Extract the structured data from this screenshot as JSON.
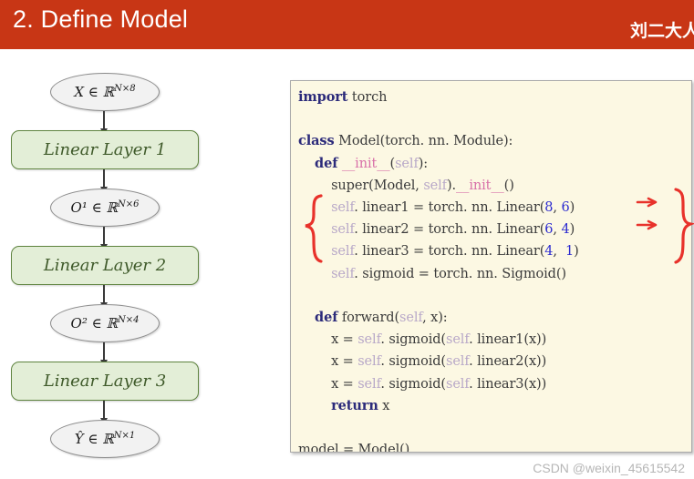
{
  "header": {
    "title": "2. Define Model",
    "author": "刘二大人",
    "bg_color": "#c83615",
    "text_color": "#ffffff"
  },
  "diagram": {
    "nodes": [
      {
        "kind": "ellipse",
        "label": "X ∈ ℝ",
        "sup": "N×8",
        "name": "node-input-x"
      },
      {
        "kind": "box",
        "label": "Linear Layer 1",
        "name": "node-linear-layer-1"
      },
      {
        "kind": "ellipse",
        "label": "O¹ ∈ ℝ",
        "sup": "N×6",
        "name": "node-output-o1"
      },
      {
        "kind": "box",
        "label": "Linear Layer 2",
        "name": "node-linear-layer-2"
      },
      {
        "kind": "ellipse",
        "label": "O² ∈ ℝ",
        "sup": "N×4",
        "name": "node-output-o2"
      },
      {
        "kind": "box",
        "label": "Linear Layer 3",
        "name": "node-linear-layer-3"
      },
      {
        "kind": "ellipse",
        "label": "Ŷ ∈ ℝ",
        "sup": "N×1",
        "name": "node-output-yhat"
      }
    ],
    "ellipse_fill": "#f2f2f2",
    "ellipse_stroke": "#8c8c8c",
    "box_fill": "#e3eed7",
    "box_stroke": "#5f8440",
    "box_text_color": "#3f5a2a",
    "arrow_color": "#3a3a3a"
  },
  "code": {
    "background": "#fcf8e3",
    "border": "#aaaaaa",
    "keyword_color": "#2b2a7a",
    "magic_color": "#d86fa8",
    "self_color": "#b8a8c8",
    "number_color": "#2b2ad0",
    "plain_color": "#3b3b3b",
    "lines": [
      {
        "tokens": [
          {
            "t": "import",
            "c": "kw"
          },
          {
            "t": " torch",
            "c": "pln"
          }
        ]
      },
      {
        "tokens": []
      },
      {
        "tokens": [
          {
            "t": "class",
            "c": "kw"
          },
          {
            "t": " Model(torch. nn. Module):",
            "c": "pln"
          }
        ]
      },
      {
        "tokens": [
          {
            "t": "    ",
            "c": "pln"
          },
          {
            "t": "def",
            "c": "kw"
          },
          {
            "t": " ",
            "c": "pln"
          },
          {
            "t": "__init__",
            "c": "mag"
          },
          {
            "t": "(",
            "c": "pln"
          },
          {
            "t": "self",
            "c": "self"
          },
          {
            "t": "):",
            "c": "pln"
          }
        ]
      },
      {
        "tokens": [
          {
            "t": "        super(Model, ",
            "c": "pln"
          },
          {
            "t": "self",
            "c": "self"
          },
          {
            "t": ").",
            "c": "pln"
          },
          {
            "t": "__init__",
            "c": "mag"
          },
          {
            "t": "()",
            "c": "pln"
          }
        ]
      },
      {
        "tokens": [
          {
            "t": "        ",
            "c": "pln"
          },
          {
            "t": "self",
            "c": "self"
          },
          {
            "t": ". linear1 = torch. nn. Linear(",
            "c": "pln"
          },
          {
            "t": "8",
            "c": "num"
          },
          {
            "t": ", ",
            "c": "pln"
          },
          {
            "t": "6",
            "c": "num"
          },
          {
            "t": ")",
            "c": "pln"
          }
        ]
      },
      {
        "tokens": [
          {
            "t": "        ",
            "c": "pln"
          },
          {
            "t": "self",
            "c": "self"
          },
          {
            "t": ". linear2 = torch. nn. Linear(",
            "c": "pln"
          },
          {
            "t": "6",
            "c": "num"
          },
          {
            "t": ", ",
            "c": "pln"
          },
          {
            "t": "4",
            "c": "num"
          },
          {
            "t": ")",
            "c": "pln"
          }
        ]
      },
      {
        "tokens": [
          {
            "t": "        ",
            "c": "pln"
          },
          {
            "t": "self",
            "c": "self"
          },
          {
            "t": ". linear3 = torch. nn. Linear(",
            "c": "pln"
          },
          {
            "t": "4",
            "c": "num"
          },
          {
            "t": ",  ",
            "c": "pln"
          },
          {
            "t": "1",
            "c": "num"
          },
          {
            "t": ")",
            "c": "pln"
          }
        ]
      },
      {
        "tokens": [
          {
            "t": "        ",
            "c": "pln"
          },
          {
            "t": "self",
            "c": "self"
          },
          {
            "t": ". sigmoid = torch. nn. Sigmoid()",
            "c": "pln"
          }
        ]
      },
      {
        "tokens": []
      },
      {
        "tokens": [
          {
            "t": "    ",
            "c": "pln"
          },
          {
            "t": "def",
            "c": "kw"
          },
          {
            "t": " forward(",
            "c": "pln"
          },
          {
            "t": "self",
            "c": "self"
          },
          {
            "t": ", x):",
            "c": "pln"
          }
        ]
      },
      {
        "tokens": [
          {
            "t": "        x = ",
            "c": "pln"
          },
          {
            "t": "self",
            "c": "self"
          },
          {
            "t": ". sigmoid(",
            "c": "pln"
          },
          {
            "t": "self",
            "c": "self"
          },
          {
            "t": ". linear1(x))",
            "c": "pln"
          }
        ]
      },
      {
        "tokens": [
          {
            "t": "        x = ",
            "c": "pln"
          },
          {
            "t": "self",
            "c": "self"
          },
          {
            "t": ". sigmoid(",
            "c": "pln"
          },
          {
            "t": "self",
            "c": "self"
          },
          {
            "t": ". linear2(x))",
            "c": "pln"
          }
        ]
      },
      {
        "tokens": [
          {
            "t": "        x = ",
            "c": "pln"
          },
          {
            "t": "self",
            "c": "self"
          },
          {
            "t": ". sigmoid(",
            "c": "pln"
          },
          {
            "t": "self",
            "c": "self"
          },
          {
            "t": ". linear3(x))",
            "c": "pln"
          }
        ]
      },
      {
        "tokens": [
          {
            "t": "        ",
            "c": "pln"
          },
          {
            "t": "return",
            "c": "kw"
          },
          {
            "t": " x",
            "c": "pln"
          }
        ]
      },
      {
        "tokens": []
      },
      {
        "tokens": [
          {
            "t": "model = Model()",
            "c": "pln"
          }
        ]
      }
    ]
  },
  "annotations": {
    "color": "#e8322b",
    "description": "red hand-drawn braces around the three linear layer lines with arrows between dimension arguments",
    "arrows": [
      {
        "from": "8",
        "to": "6"
      },
      {
        "from": "6",
        "to": "4"
      }
    ]
  },
  "watermark": {
    "text": "CSDN @weixin_45615542",
    "color": "#b6b6b6"
  }
}
